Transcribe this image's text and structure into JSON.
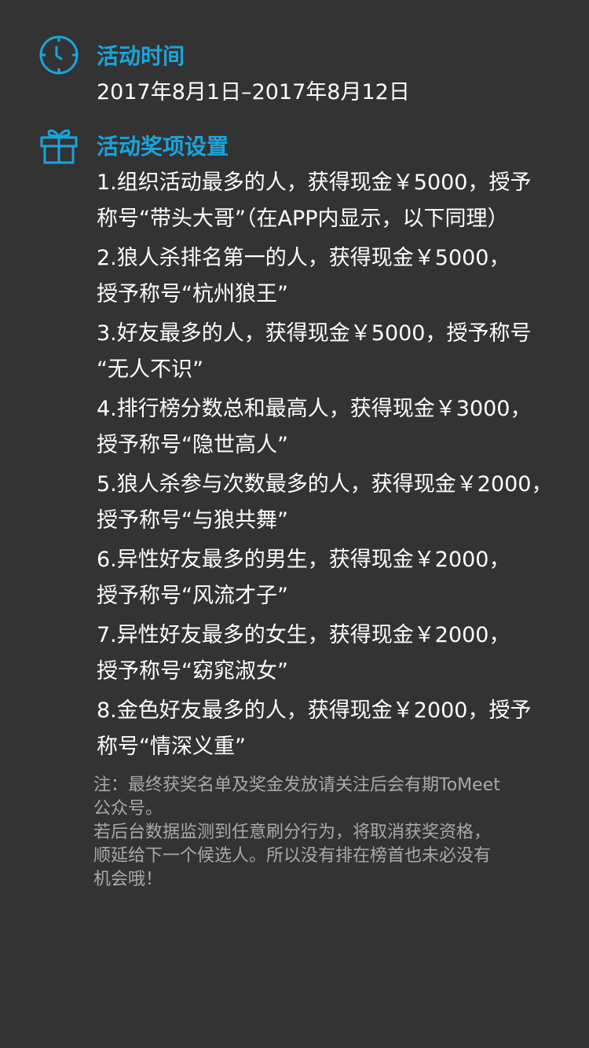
{
  "accent_color": "#1ba4dc",
  "background_color": "#333333",
  "time_section": {
    "icon": "clock-icon",
    "title": "活动时间",
    "date_range": "2017年8月1日–2017年8月12日"
  },
  "awards_section": {
    "icon": "gift-icon",
    "title": "活动奖项设置",
    "items": [
      {
        "line1": "1.组织活动最多的人，获得现金￥5000，授予",
        "line2": "称号“带头大哥”（在APP内显示，以下同理）"
      },
      {
        "line1": "2.狼人杀排名第一的人，获得现金￥5000，",
        "line2": "授予称号“杭州狼王”"
      },
      {
        "line1": "3.好友最多的人，获得现金￥5000，授予称号",
        "line2": "“无人不识”"
      },
      {
        "line1": "4.排行榜分数总和最高人，获得现金￥3000，",
        "line2": "授予称号“隐世高人”"
      },
      {
        "line1": "5.狼人杀参与次数最多的人，获得现金￥2000，",
        "line2": "授予称号“与狼共舞”"
      },
      {
        "line1": "6.异性好友最多的男生，获得现金￥2000，",
        "line2": "授予称号“风流才子”"
      },
      {
        "line1": "7.异性好友最多的女生，获得现金￥2000，",
        "line2": "授予称号“窈窕淑女”"
      },
      {
        "line1": "8.金色好友最多的人，获得现金￥2000，授予",
        "line2": "称号“情深义重”"
      }
    ]
  },
  "note": {
    "lines": [
      "注：最终获奖名单及奖金发放请关注后会有期ToMeet",
      "公众号。",
      "若后台数据监测到任意刷分行为，将取消获奖资格，",
      "顺延给下一个候选人。所以没有排在榜首也未必没有",
      "机会哦！"
    ]
  }
}
